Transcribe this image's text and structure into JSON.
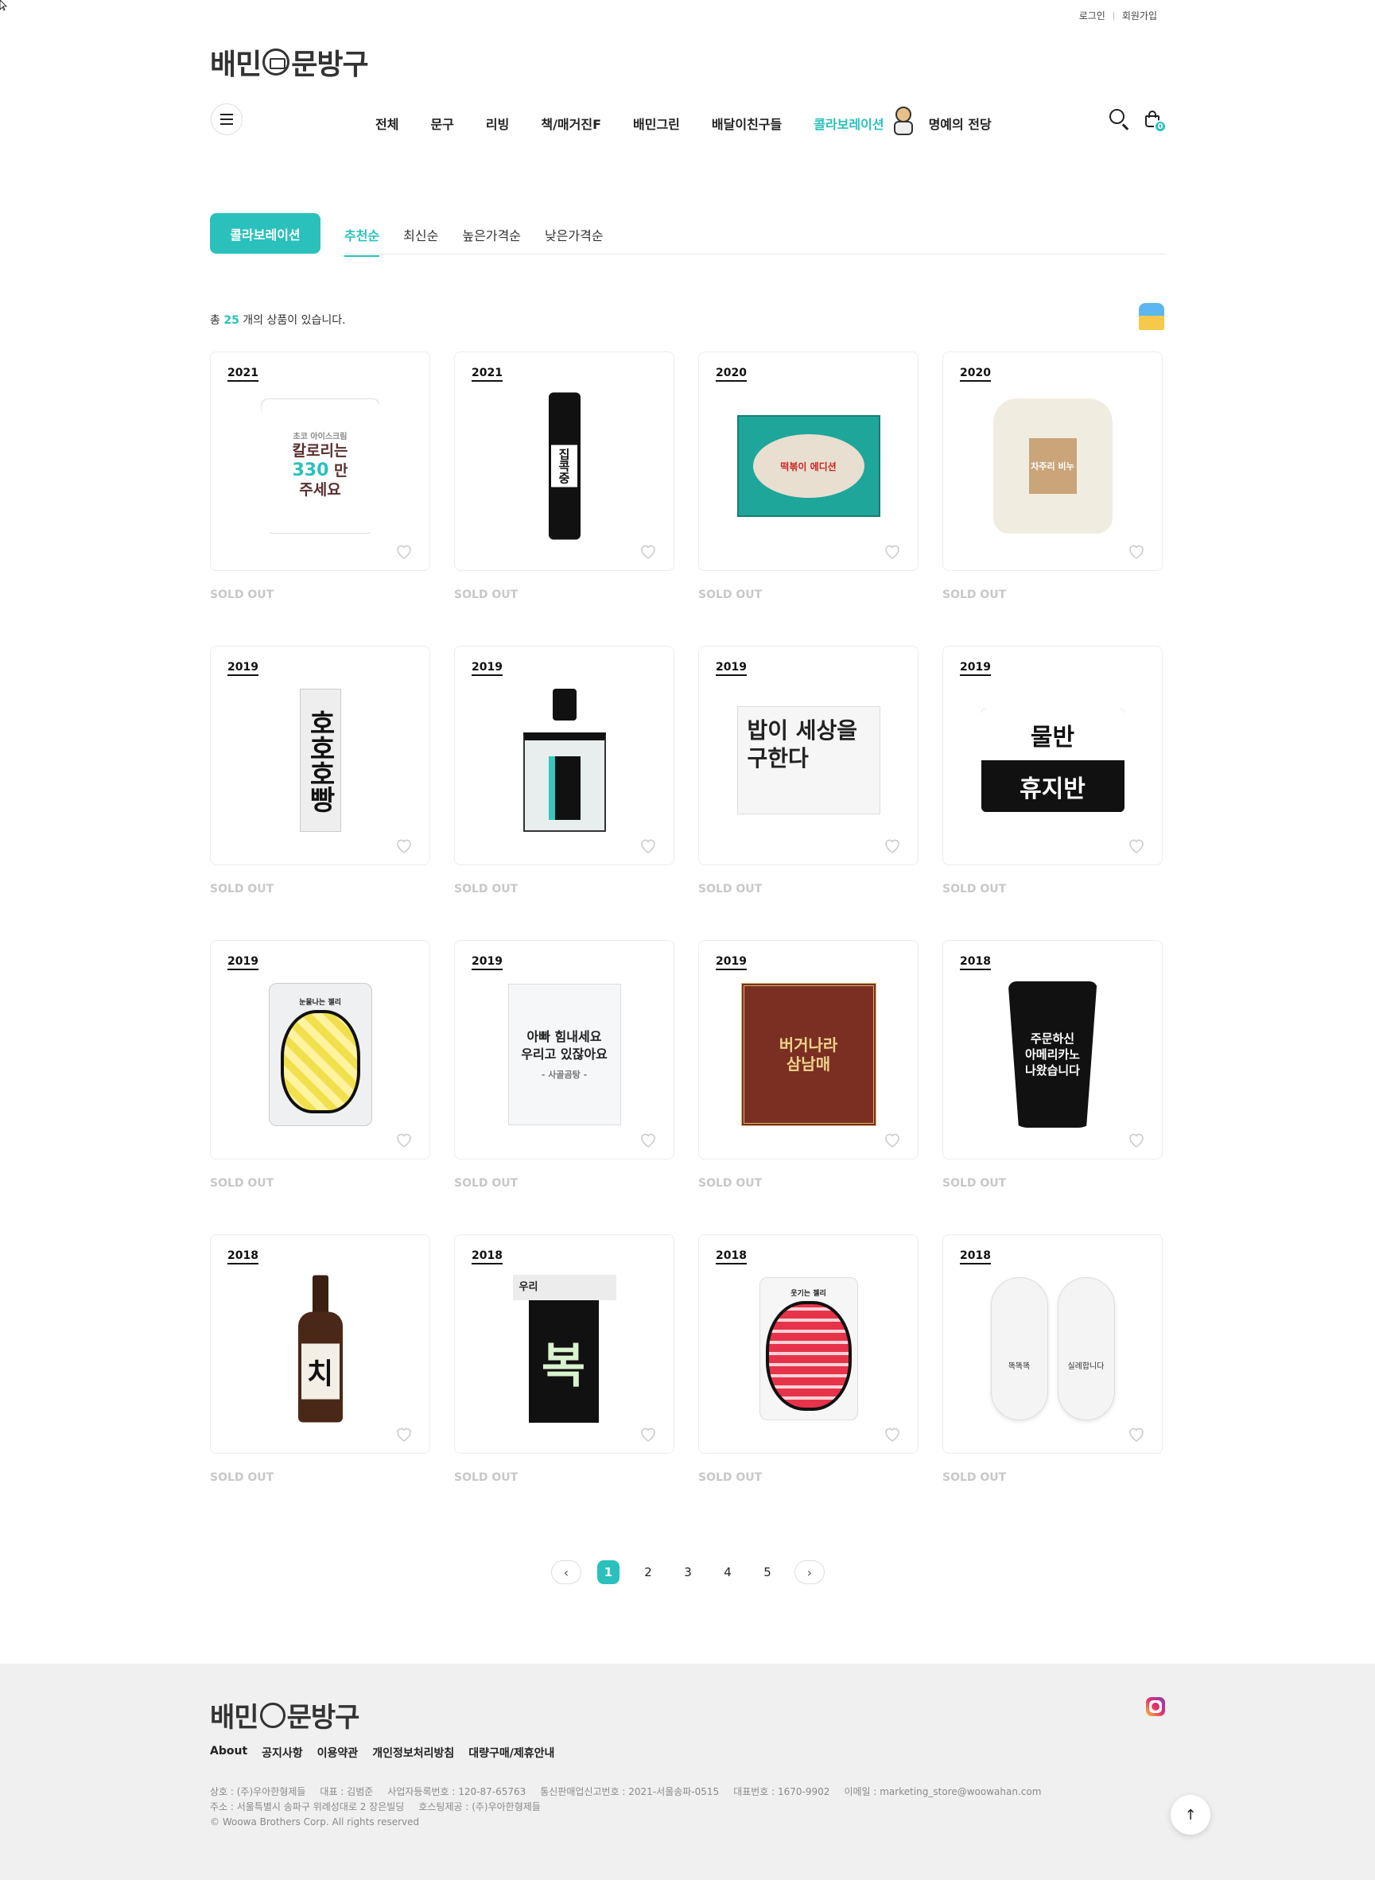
{
  "util": {
    "login": "로그인",
    "signup": "회원가입"
  },
  "logo": {
    "left": "배민",
    "right": "문방구"
  },
  "nav": {
    "items": [
      "전체",
      "문구",
      "리빙",
      "책/매거진F",
      "배민그린",
      "배달이친구들"
    ],
    "collab": "콜라보레이션",
    "hall": "명예의 전당",
    "cart_count": "0"
  },
  "filter": {
    "category": "콜라보레이션",
    "sorts": [
      "추천순",
      "최신순",
      "높은가격순",
      "낮은가격순"
    ],
    "active_sort": "추천순"
  },
  "count": {
    "prefix": "총 ",
    "number": "25",
    "suffix": " 개의 상품이 있습니다."
  },
  "products": [
    {
      "year": "2021",
      "status": "SOLD OUT",
      "visual": "cup",
      "text": [
        "초코 아이스크림",
        "칼로리는",
        "330",
        "만",
        "주세요"
      ]
    },
    {
      "year": "2021",
      "status": "SOLD OUT",
      "visual": "tube",
      "text": [
        "집",
        "콕",
        "중"
      ]
    },
    {
      "year": "2020",
      "status": "SOLD OUT",
      "visual": "tray",
      "text": [
        "떡볶이 에디션"
      ]
    },
    {
      "year": "2020",
      "status": "SOLD OUT",
      "visual": "pouch",
      "text": [
        "차주리 비누"
      ]
    },
    {
      "year": "2019",
      "status": "SOLD OUT",
      "visual": "vertical",
      "text": [
        "호호호빵"
      ]
    },
    {
      "year": "2019",
      "status": "SOLD OUT",
      "visual": "lanyard",
      "text": []
    },
    {
      "year": "2019",
      "status": "SOLD OUT",
      "visual": "box",
      "text": [
        "밥이 세상을",
        "구한다"
      ]
    },
    {
      "year": "2019",
      "status": "SOLD OUT",
      "visual": "tissue",
      "text": [
        "물반",
        "휴지반"
      ]
    },
    {
      "year": "2019",
      "status": "SOLD OUT",
      "visual": "jelly",
      "text": [
        "눈물나는 젤리"
      ]
    },
    {
      "year": "2019",
      "status": "SOLD OUT",
      "visual": "card",
      "text": [
        "아빠 힘내세요",
        "우리고 있잖아요",
        "- 사골곰탕 -"
      ]
    },
    {
      "year": "2019",
      "status": "SOLD OUT",
      "visual": "book",
      "text": [
        "버거나라",
        "삼남매"
      ]
    },
    {
      "year": "2018",
      "status": "SOLD OUT",
      "visual": "coffee",
      "text": [
        "주문하신",
        "아메리카노",
        "나왔습니다"
      ]
    },
    {
      "year": "2018",
      "status": "SOLD OUT",
      "visual": "beer",
      "text": [
        "치"
      ]
    },
    {
      "year": "2018",
      "status": "SOLD OUT",
      "visual": "bok",
      "text": [
        "우리",
        "복"
      ]
    },
    {
      "year": "2018",
      "status": "SOLD OUT",
      "visual": "redjelly",
      "text": [
        "웃기는 젤리"
      ]
    },
    {
      "year": "2018",
      "status": "SOLD OUT",
      "visual": "slippers",
      "text": [
        "똑똑똑",
        "실례합니다"
      ]
    }
  ],
  "pagination": {
    "prev": "‹",
    "next": "›",
    "pages": [
      "1",
      "2",
      "3",
      "4",
      "5"
    ],
    "current": "1"
  },
  "footer": {
    "links": [
      "About",
      "공지사항",
      "이용약관",
      "개인정보처리방침",
      "대량구매/제휴안내"
    ],
    "info_row1": [
      "상호 : (주)우아한형제들",
      "대표 : 김범준",
      "사업자등록번호 : 120-87-65763",
      "통신판매업신고번호 : 2021-서울송파-0515",
      "대표번호 : 1670-9902",
      "이메일 : marketing_store@woowahan.com"
    ],
    "info_row2": [
      "주소 : 서울특별시 송파구 위례성대로 2 장은빌딩",
      "호스팅제공 : (주)우아한형제들"
    ],
    "copyright": "© Woowa Brothers Corp. All rights reserved",
    "top": "↑"
  },
  "colors": {
    "accent": "#2ac1bc",
    "sold_out": "#c8c8c8",
    "footer_bg": "#f0f0f0"
  }
}
